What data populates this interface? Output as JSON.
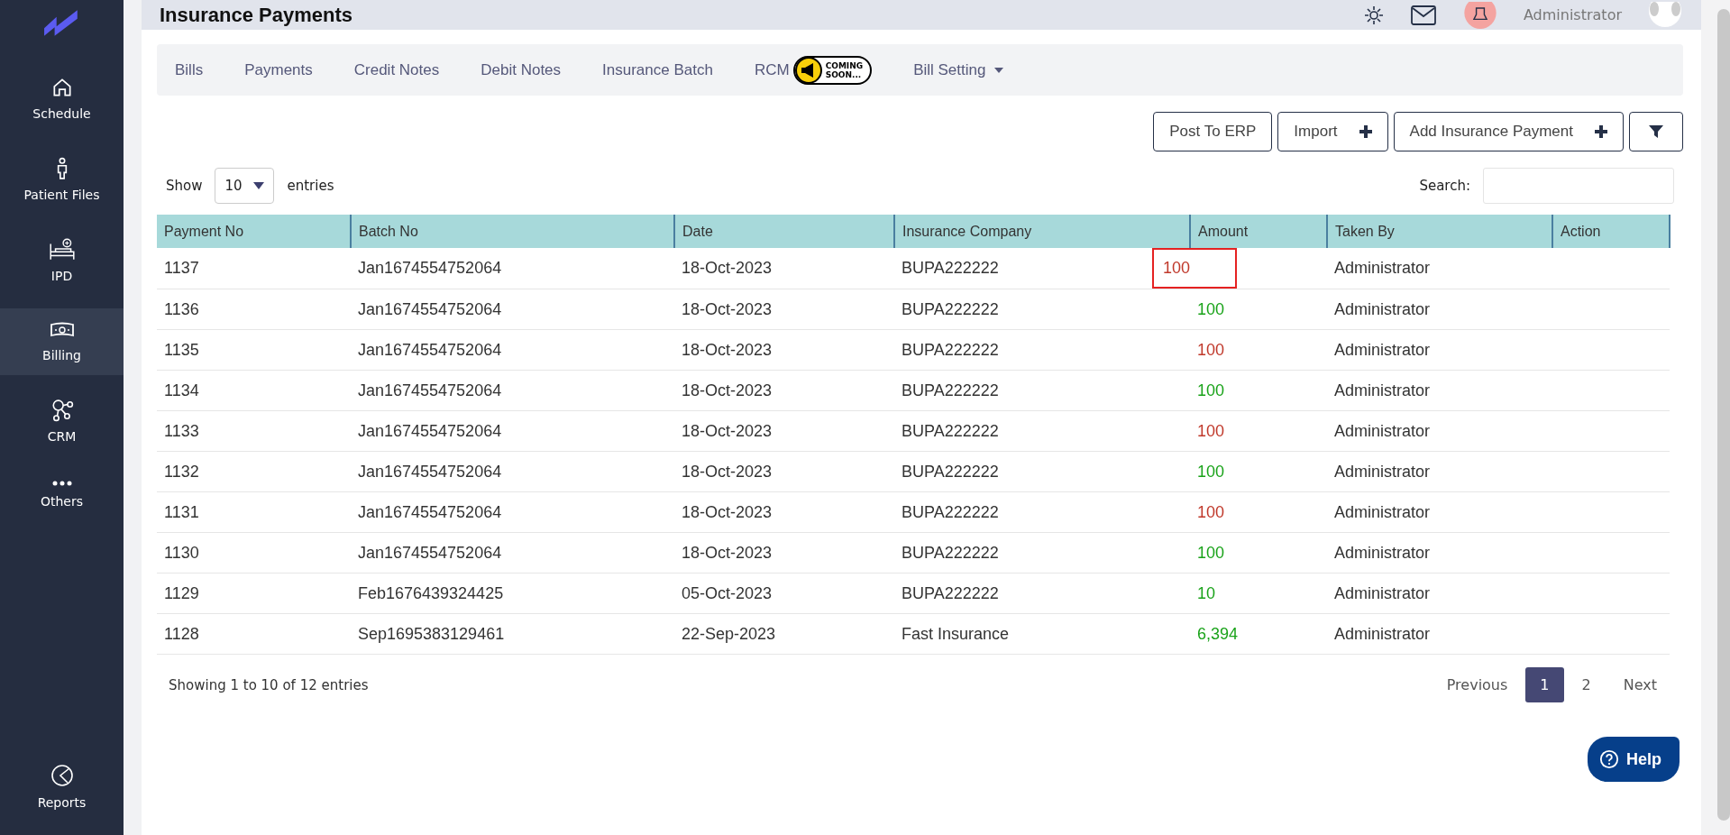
{
  "sidebar": {
    "items": [
      {
        "label": "Schedule",
        "kind": "home",
        "selected": false
      },
      {
        "label": "Patient Files",
        "kind": "person",
        "selected": false
      },
      {
        "label": "IPD",
        "kind": "bed",
        "selected": false
      },
      {
        "label": "Billing",
        "kind": "money",
        "selected": true
      },
      {
        "label": "CRM",
        "kind": "nodes",
        "selected": false
      },
      {
        "label": "Others",
        "kind": "dots",
        "selected": false
      }
    ],
    "bottom_item": {
      "label": "Reports",
      "kind": "pie",
      "selected": false
    }
  },
  "header": {
    "title": "Insurance Payments",
    "user": "Administrator"
  },
  "tabs": [
    {
      "label": "Bills",
      "kind": "plain"
    },
    {
      "label": "Payments",
      "kind": "plain"
    },
    {
      "label": "Credit Notes",
      "kind": "plain"
    },
    {
      "label": "Debit Notes",
      "kind": "plain"
    },
    {
      "label": "Insurance Batch",
      "kind": "plain"
    },
    {
      "label": "RCM",
      "kind": "badge",
      "badge_lines": [
        "COMING",
        "SOON..."
      ]
    },
    {
      "label": "Bill Setting",
      "kind": "dropdown"
    }
  ],
  "actions": [
    {
      "label": "Post To ERP",
      "kind": "text"
    },
    {
      "label": "Import",
      "kind": "plus"
    },
    {
      "label": "Add Insurance Payment",
      "kind": "plus"
    },
    {
      "kind": "filter"
    }
  ],
  "length_menu": {
    "before": "Show",
    "value": "10",
    "after": "entries"
  },
  "search": {
    "label": "Search:"
  },
  "table": {
    "columns": [
      "Payment No",
      "Batch No",
      "Date",
      "Insurance Company",
      "Amount",
      "Taken By",
      "Action"
    ],
    "rows": [
      {
        "cells": [
          "1137",
          "Jan1674554752064",
          "18-Oct-2023",
          "BUPA222222",
          "100",
          "Administrator"
        ],
        "color": "#c0392b",
        "highlighted": true
      },
      {
        "cells": [
          "1136",
          "Jan1674554752064",
          "18-Oct-2023",
          "BUPA222222",
          "100",
          "Administrator"
        ],
        "color": "#1aa31a",
        "highlighted": false
      },
      {
        "cells": [
          "1135",
          "Jan1674554752064",
          "18-Oct-2023",
          "BUPA222222",
          "100",
          "Administrator"
        ],
        "color": "#c0392b",
        "highlighted": false
      },
      {
        "cells": [
          "1134",
          "Jan1674554752064",
          "18-Oct-2023",
          "BUPA222222",
          "100",
          "Administrator"
        ],
        "color": "#1aa31a",
        "highlighted": false
      },
      {
        "cells": [
          "1133",
          "Jan1674554752064",
          "18-Oct-2023",
          "BUPA222222",
          "100",
          "Administrator"
        ],
        "color": "#c0392b",
        "highlighted": false
      },
      {
        "cells": [
          "1132",
          "Jan1674554752064",
          "18-Oct-2023",
          "BUPA222222",
          "100",
          "Administrator"
        ],
        "color": "#1aa31a",
        "highlighted": false
      },
      {
        "cells": [
          "1131",
          "Jan1674554752064",
          "18-Oct-2023",
          "BUPA222222",
          "100",
          "Administrator"
        ],
        "color": "#c0392b",
        "highlighted": false
      },
      {
        "cells": [
          "1130",
          "Jan1674554752064",
          "18-Oct-2023",
          "BUPA222222",
          "100",
          "Administrator"
        ],
        "color": "#1aa31a",
        "highlighted": false
      },
      {
        "cells": [
          "1129",
          "Feb1676439324425",
          "05-Oct-2023",
          "BUPA222222",
          "10",
          "Administrator"
        ],
        "color": "#1aa31a",
        "highlighted": false
      },
      {
        "cells": [
          "1128",
          "Sep1695383129461",
          "22-Sep-2023",
          "Fast Insurance",
          "6,394",
          "Administrator"
        ],
        "color": "#1aa31a",
        "highlighted": false
      }
    ]
  },
  "info": "Showing 1 to 10 of 12 entries",
  "pagination": [
    {
      "label": "Previous",
      "selected": false
    },
    {
      "label": "1",
      "selected": true
    },
    {
      "label": "2",
      "selected": false
    },
    {
      "label": "Next",
      "selected": false
    }
  ],
  "help": {
    "label": "Help"
  }
}
